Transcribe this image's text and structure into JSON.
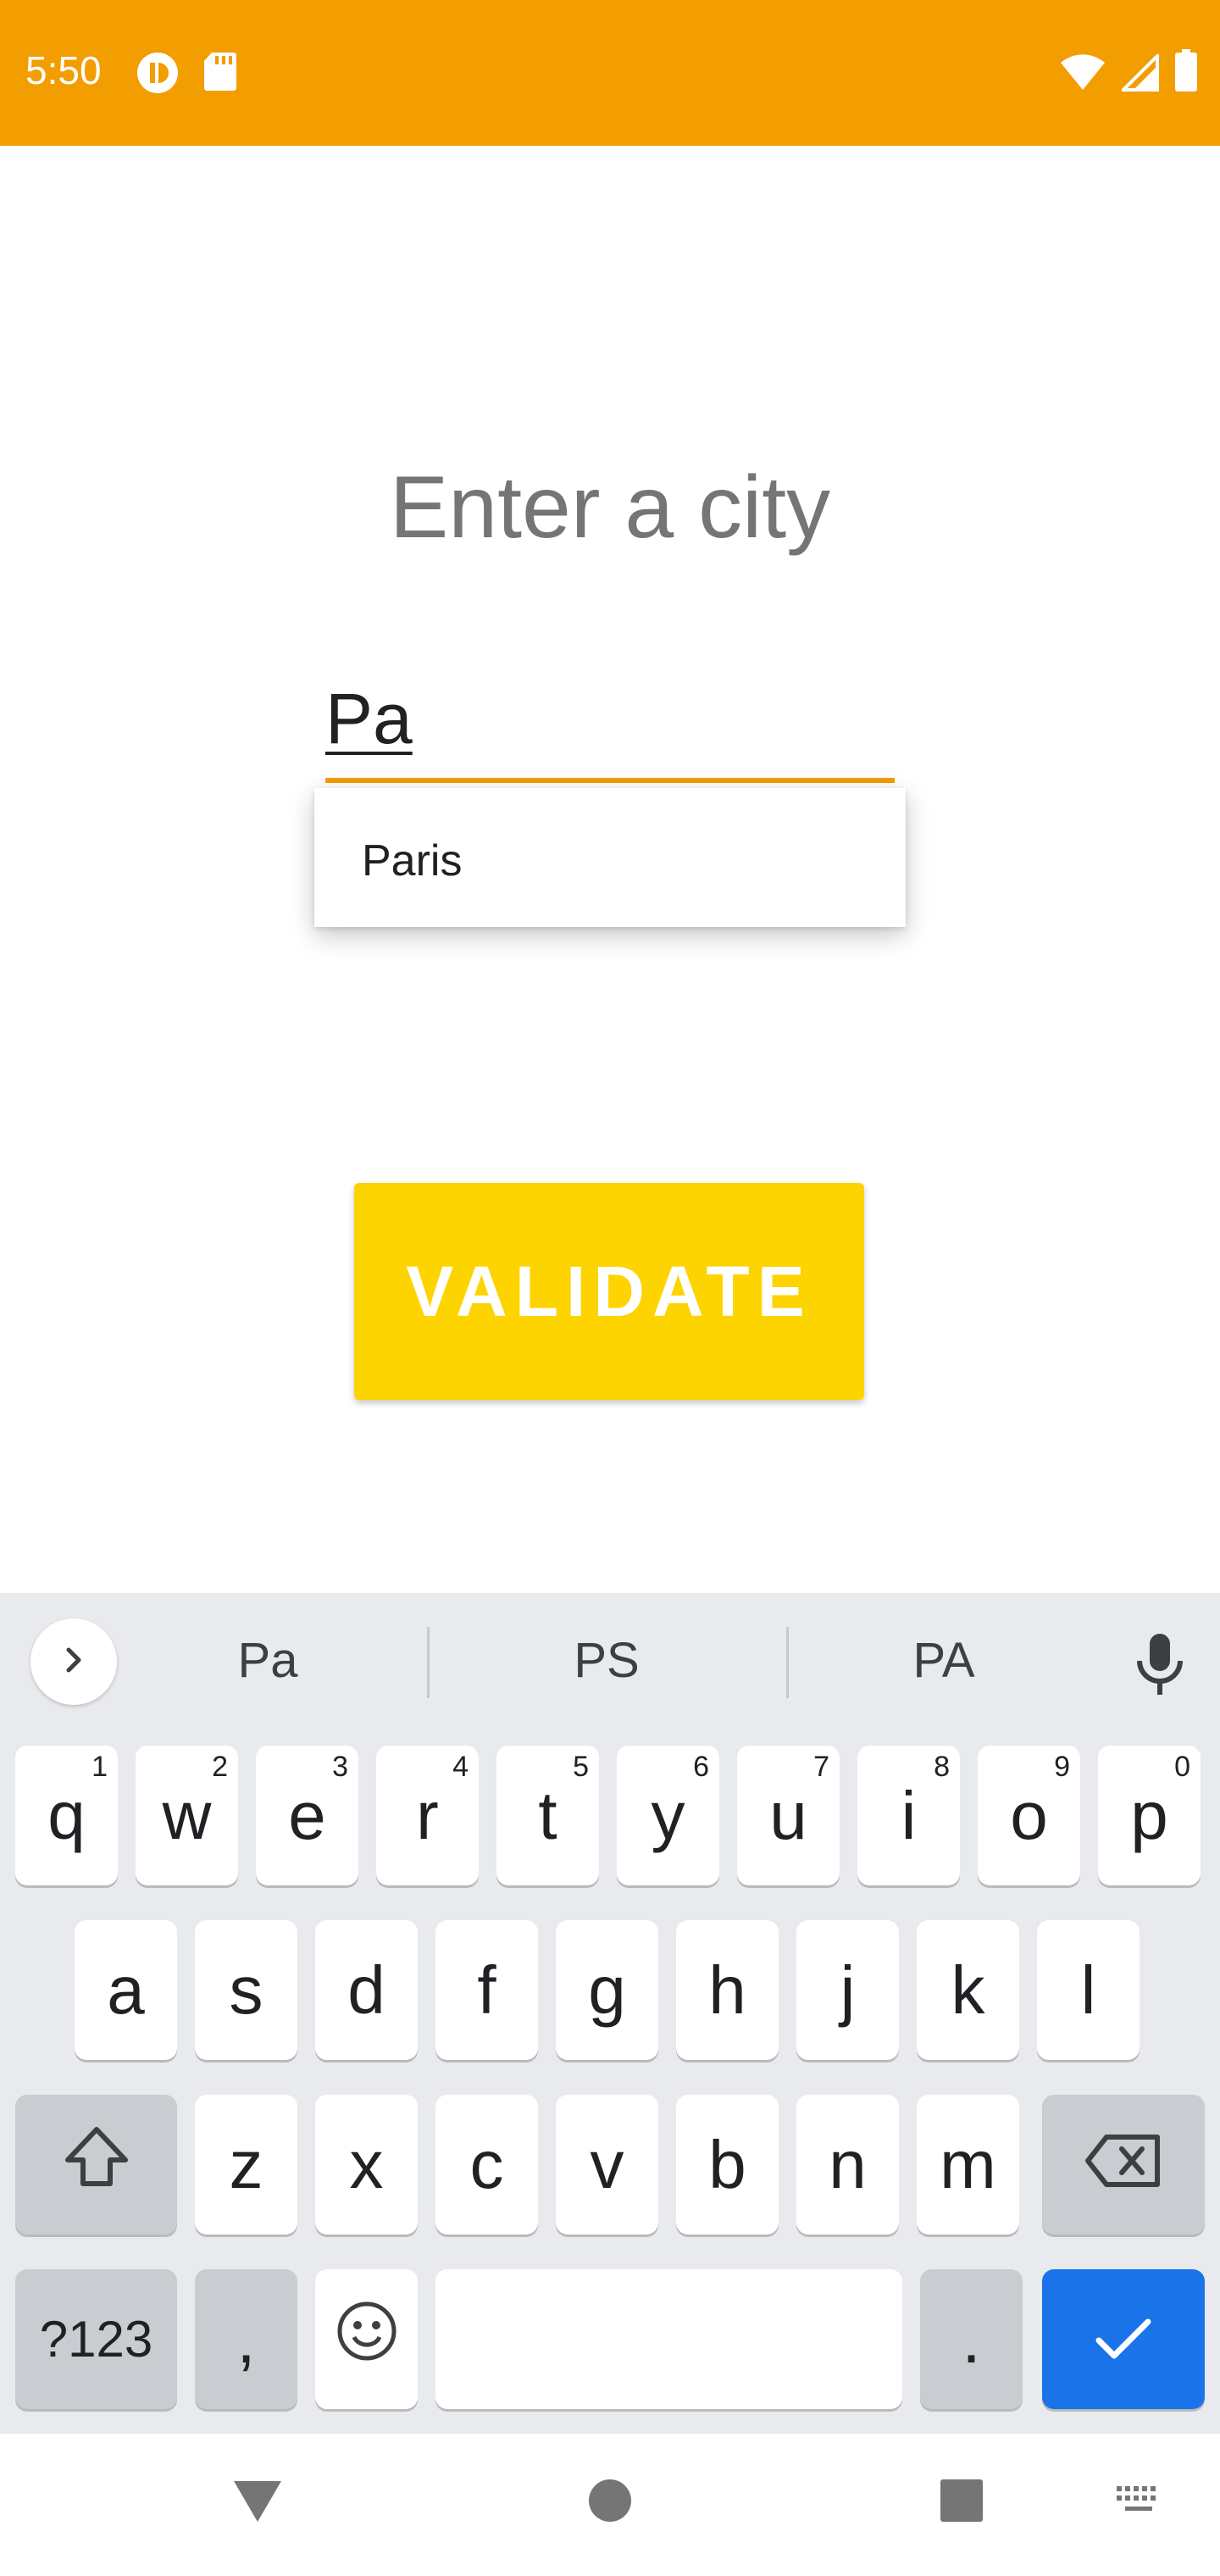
{
  "status_bar": {
    "time": "5:50",
    "background": "#F29D00"
  },
  "form": {
    "title": "Enter a city",
    "input_value": "Pa",
    "suggestions": [
      "Paris"
    ],
    "validate_label": "VALIDATE",
    "accent": "#F29D00",
    "button_color": "#FDD300"
  },
  "keyboard": {
    "suggestions": [
      "Pa",
      "PS",
      "PA"
    ],
    "row1": [
      {
        "key": "q",
        "hint": "1"
      },
      {
        "key": "w",
        "hint": "2"
      },
      {
        "key": "e",
        "hint": "3"
      },
      {
        "key": "r",
        "hint": "4"
      },
      {
        "key": "t",
        "hint": "5"
      },
      {
        "key": "y",
        "hint": "6"
      },
      {
        "key": "u",
        "hint": "7"
      },
      {
        "key": "i",
        "hint": "8"
      },
      {
        "key": "o",
        "hint": "9"
      },
      {
        "key": "p",
        "hint": "0"
      }
    ],
    "row2": [
      "a",
      "s",
      "d",
      "f",
      "g",
      "h",
      "j",
      "k",
      "l"
    ],
    "row3": [
      "z",
      "x",
      "c",
      "v",
      "b",
      "n",
      "m"
    ],
    "symbols_label": "?123",
    "comma": ",",
    "period": ".",
    "enter_color": "#1A73E8"
  },
  "icons": [
    "sync-icon",
    "sd-card-icon",
    "wifi-icon",
    "signal-icon",
    "battery-icon",
    "chevron-right-icon",
    "mic-icon",
    "shift-icon",
    "backspace-icon",
    "emoji-icon",
    "check-icon",
    "back-icon",
    "home-icon",
    "recents-icon",
    "keyboard-icon"
  ]
}
